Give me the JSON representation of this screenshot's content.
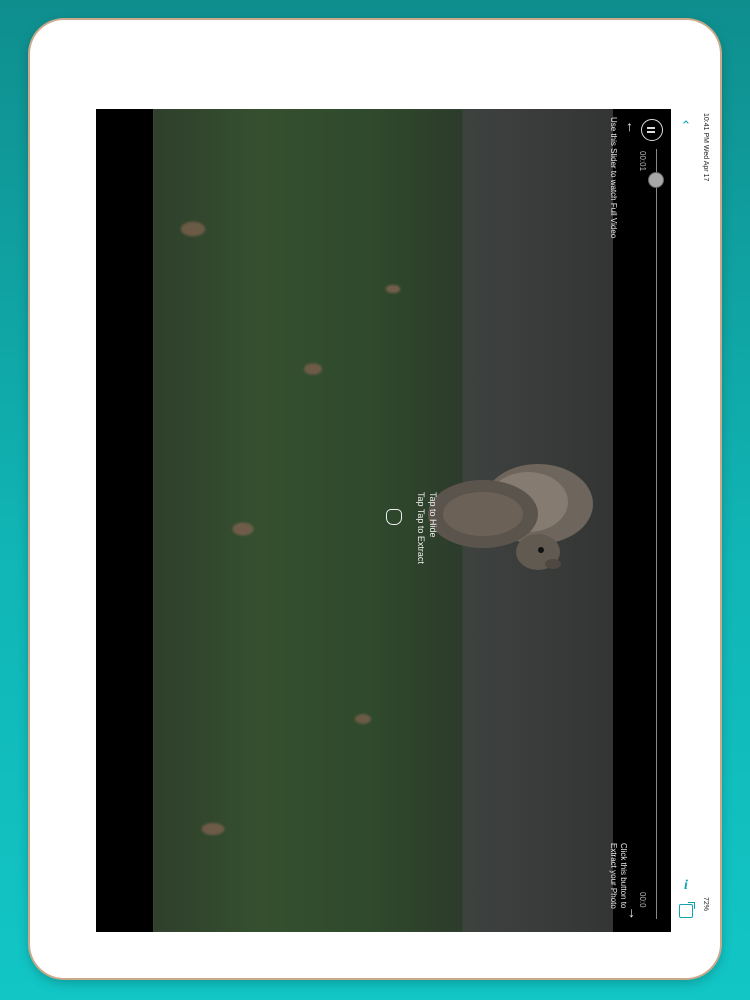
{
  "status": {
    "time_date": "10:41 PM  Wed Apr 17",
    "battery": "72%"
  },
  "player": {
    "elapsed": "00:01",
    "total": "00:0",
    "slider_hint": "Use this Slider to watch Full Video",
    "extract_hint": "Click this button to Extract your Photo",
    "tap_hint_line1": "Tap to Hide",
    "tap_hint_line2": "Tap Tap to Extract"
  },
  "icons": {
    "back": "chevron-left-icon",
    "info": "info-icon",
    "share": "share-icon",
    "pause": "pause-icon",
    "hand": "hand-tap-icon"
  },
  "colors": {
    "accent": "#10a3b3",
    "background": "#12b8b8"
  }
}
